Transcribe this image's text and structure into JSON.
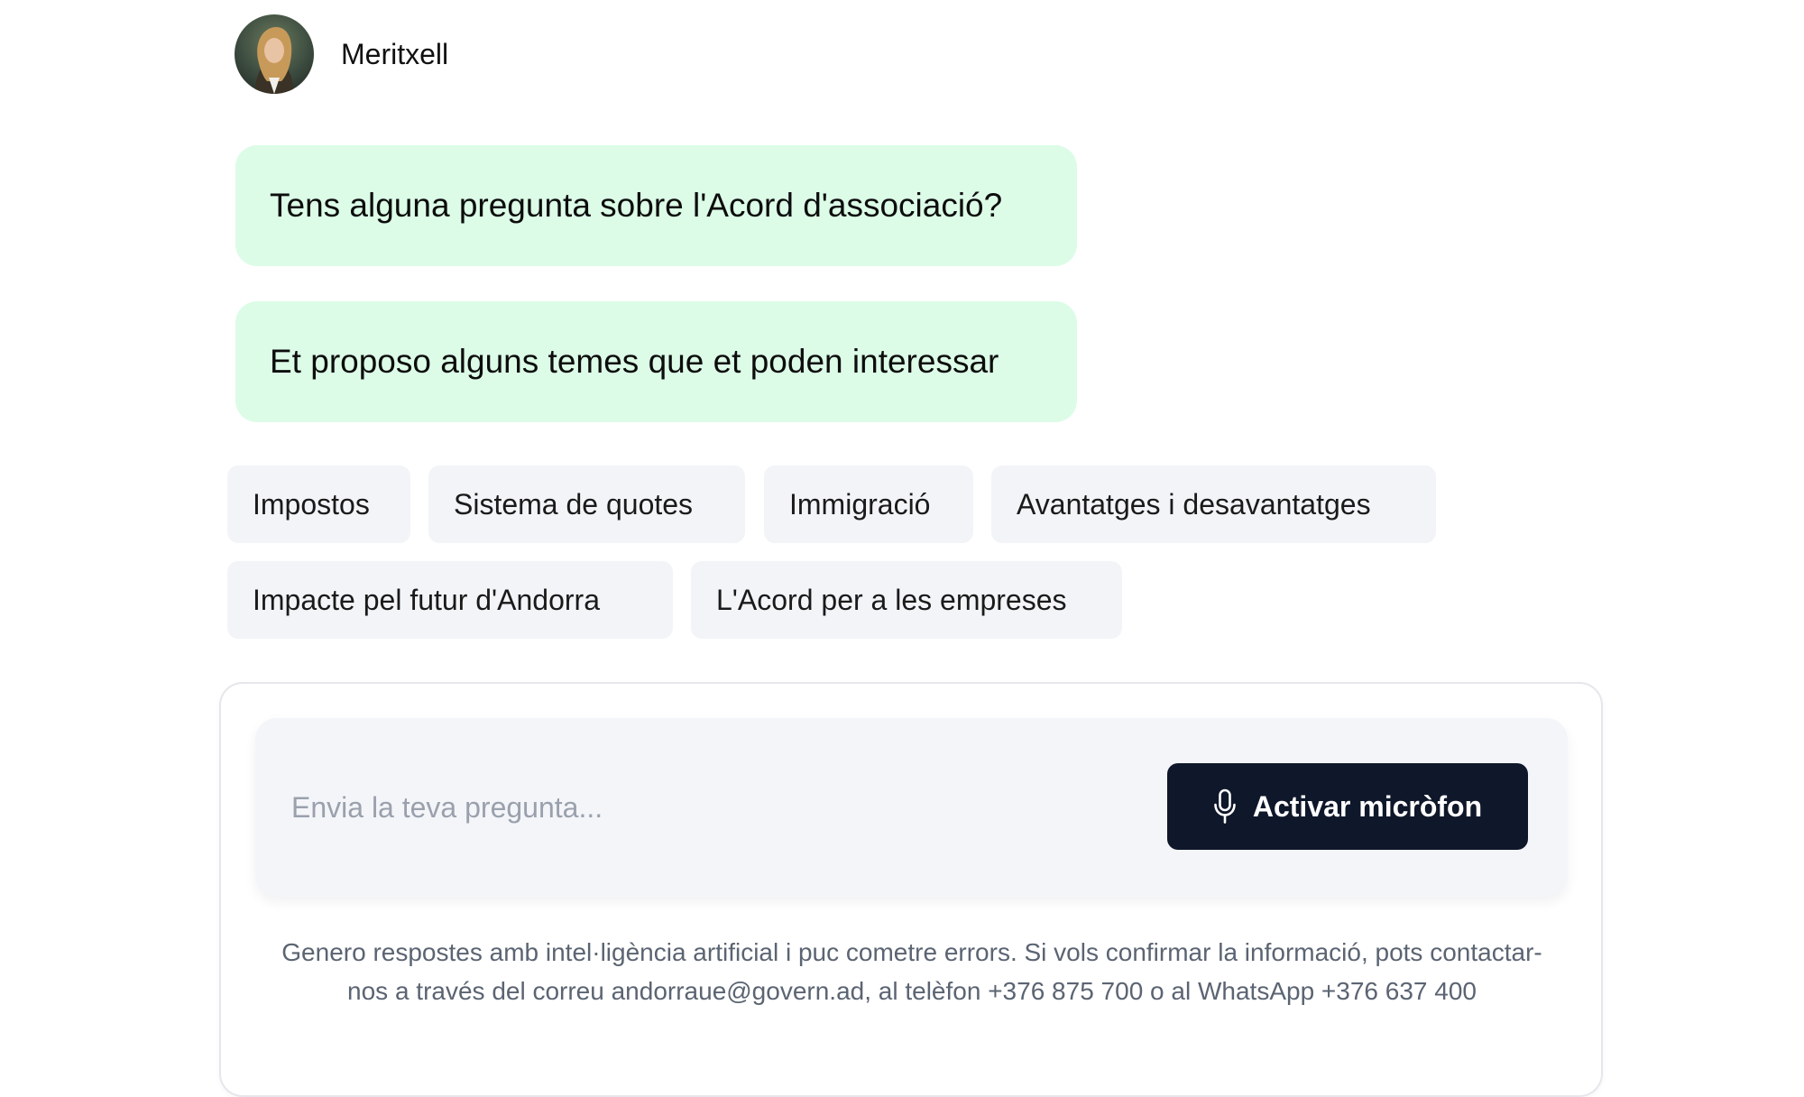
{
  "header": {
    "bot_name": "Meritxell"
  },
  "messages": [
    "Tens alguna pregunta sobre l'Acord d'associació?",
    "Et proposo alguns temes que et poden interessar"
  ],
  "suggestions": [
    "Impostos",
    "Sistema de quotes",
    "Immigració",
    "Avantatges i desavantatges",
    "Impacte pel futur d'Andorra",
    "L'Acord per a les empreses"
  ],
  "composer": {
    "placeholder": "Envia la teva pregunta...",
    "mic_button_label": "Activar micròfon",
    "mic_icon": "microphone-icon",
    "disclaimer": "Genero respostes amb intel·ligència artificial i puc cometre errors. Si vols confirmar la informació, pots contactar-nos a través del correu andorraue@govern.ad, al telèfon +376 875 700 o al WhatsApp +376 637 400"
  },
  "colors": {
    "bubble_bg": "#dcfce7",
    "chip_bg": "#f2f4f7",
    "input_bg": "#f3f5f9",
    "button_bg": "#0f172a",
    "disclaimer_text": "#5b6472"
  }
}
